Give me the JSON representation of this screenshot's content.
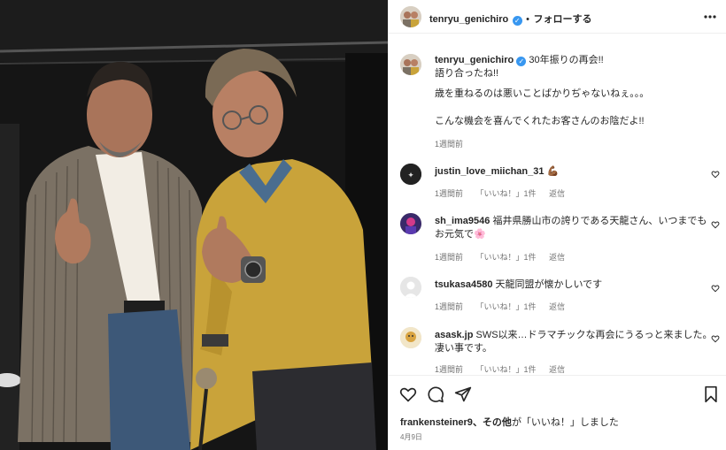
{
  "post_image": {
    "description_icon": "photo-two-men-thumbs-up"
  },
  "header": {
    "username": "tenryu_genichiro",
    "verified_icon": "verified-badge-icon",
    "separator": "•",
    "follow_label": "フォローする",
    "more_icon": "more-horizontal-icon"
  },
  "caption": {
    "username": "tenryu_genichiro",
    "line1": "30年振りの再会!!",
    "line2": "語り合ったね!!",
    "line3": "歳を重ねるのは悪いことばかりぢゃないねぇ。。。",
    "line4": "こんな機会を喜んでくれたお客さんのお陰だよ!!",
    "time": "1週間前"
  },
  "comments": [
    {
      "username": "justin_love_miichan_31",
      "text": "💪🏾",
      "time": "1週間前",
      "likes": "「いいね！」1件",
      "reply": "返信"
    },
    {
      "username": "sh_ima9546",
      "text": "福井県勝山市の誇りである天龍さん、いつまでも",
      "text2": "お元気で🌸",
      "time": "1週間前",
      "likes": "「いいね！」1件",
      "reply": "返信"
    },
    {
      "username": "tsukasa4580",
      "text": "天龍同盟が懐かしいです",
      "time": "1週間前",
      "likes": "「いいね！」1件",
      "reply": "返信"
    },
    {
      "username": "asask.jp",
      "text": "SWS以来…ドラマチックな再会にうるっと来ました。",
      "text2": "凄い事です。",
      "time": "1週間前",
      "likes": "「いいね！」1件",
      "reply": "返信"
    }
  ],
  "actions": {
    "like_icon": "heart-icon",
    "comment_icon": "comment-icon",
    "share_icon": "paper-plane-icon",
    "save_icon": "bookmark-icon",
    "likes_user": "frankensteiner9",
    "likes_rest": "、その他",
    "likes_suffix": "が「いいね！」しました",
    "date": "4月9日"
  },
  "colors": {
    "text": "#262626",
    "secondary": "#737373",
    "verified": "#3897f0",
    "border": "#efefef"
  }
}
